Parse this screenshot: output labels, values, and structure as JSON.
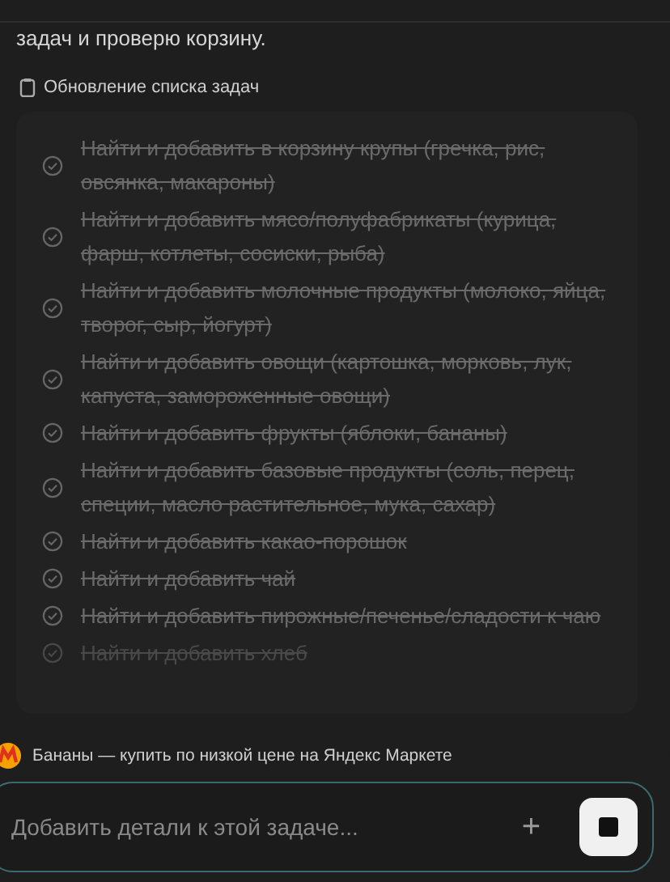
{
  "message": {
    "text": "задач и проверю корзину."
  },
  "task_update": {
    "label": "Обновление списка задач",
    "tasks": [
      {
        "text": "Найти и добавить в корзину крупы (гречка, рис, овсянка, макароны)",
        "done": true
      },
      {
        "text": "Найти и добавить мясо/полуфабрикаты (курица, фарш, котлеты, сосиски, рыба)",
        "done": true
      },
      {
        "text": "Найти и добавить молочные продукты (молоко, яйца, творог, сыр, йогурт)",
        "done": true
      },
      {
        "text": "Найти и добавить овощи (картошка, морковь, лук, капуста, замороженные овощи)",
        "done": true
      },
      {
        "text": "Найти и добавить фрукты (яблоки, бананы)",
        "done": true
      },
      {
        "text": "Найти и добавить базовые продукты (соль, перец, специи, масло растительное, мука, сахар)",
        "done": true
      },
      {
        "text": "Найти и добавить какао-порошок",
        "done": true
      },
      {
        "text": "Найти и добавить чай",
        "done": true
      },
      {
        "text": "Найти и добавить пирожные/печенье/сладости к чаю",
        "done": true
      },
      {
        "text": "Найти и добавить хлеб",
        "done": true
      }
    ]
  },
  "current_tab": {
    "title": "Бананы — купить по низкой цене на Яндекс Маркете"
  },
  "composer": {
    "placeholder": "Добавить детали к этой задаче...",
    "add_label": "+"
  }
}
